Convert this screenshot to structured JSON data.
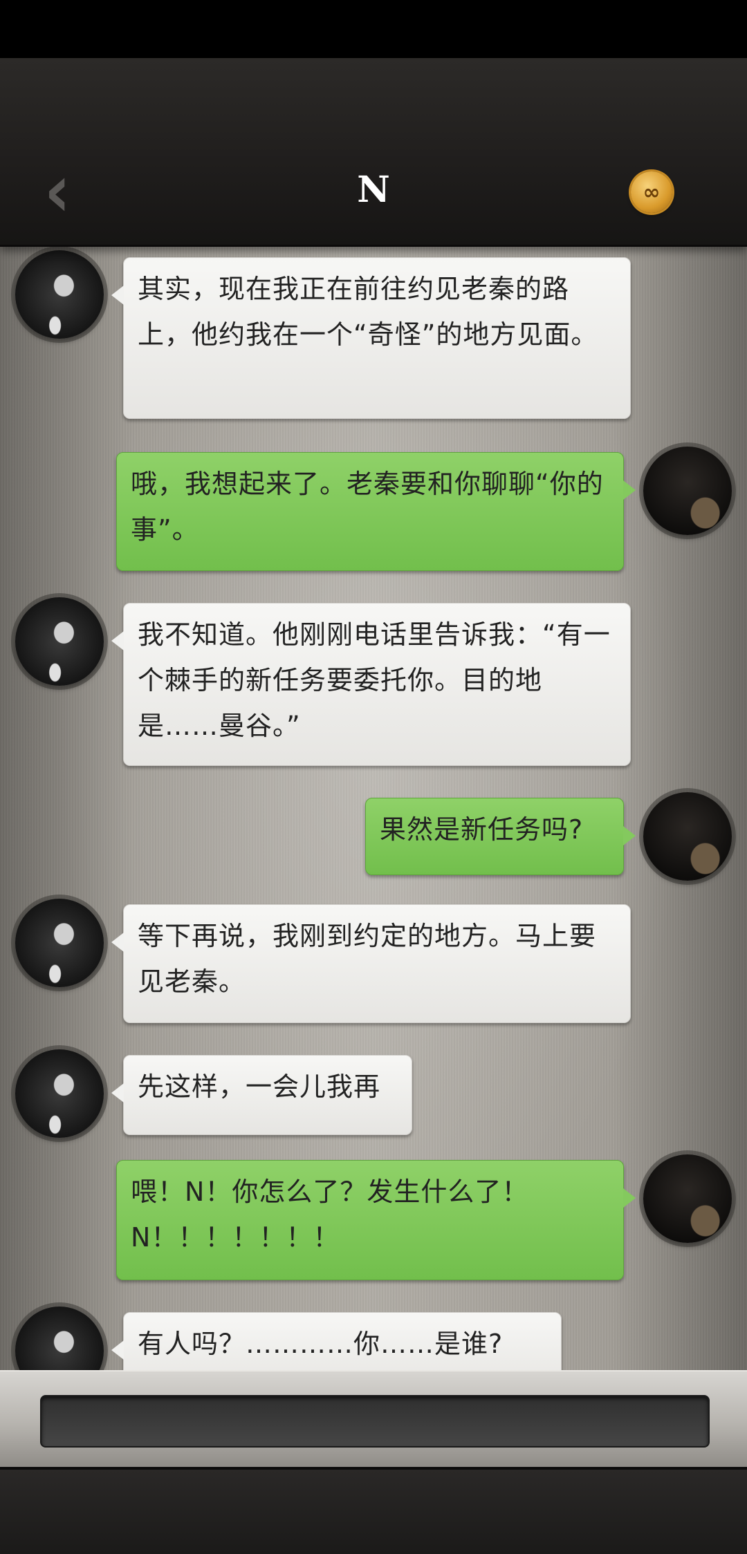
{
  "header": {
    "title": "N",
    "back_icon": "chevron-left-icon",
    "badge_icon": "infinity-badge-icon",
    "badge_symbol": "∞"
  },
  "messages": [
    {
      "sender": "N",
      "side": "left",
      "text": "其实，现在我正在前往约见老秦的路上，他约我在一个“奇怪”的地方见面。"
    },
    {
      "sender": "me",
      "side": "right",
      "text": "哦，我想起来了。老秦要和你聊聊“你的事”。"
    },
    {
      "sender": "N",
      "side": "left",
      "text": "我不知道。他刚刚电话里告诉我：“有一个棘手的新任务要委托你。目的地是……曼谷。”"
    },
    {
      "sender": "me",
      "side": "right",
      "text": "果然是新任务吗?"
    },
    {
      "sender": "N",
      "side": "left",
      "text": "等下再说，我刚到约定的地方。马上要见老秦。"
    },
    {
      "sender": "N",
      "side": "left",
      "text": "先这样，一会儿我再"
    },
    {
      "sender": "me",
      "side": "right",
      "text": "喂！N！你怎么了？发生什么了！N！！！！！！！"
    },
    {
      "sender": "N",
      "side": "left",
      "text": "有人吗？…………你……是谁?"
    }
  ],
  "colors": {
    "bubble_left": "#f1f1ef",
    "bubble_right": "#7cc655",
    "header_bg": "#1f1d1c",
    "badge": "#d99a2b"
  }
}
